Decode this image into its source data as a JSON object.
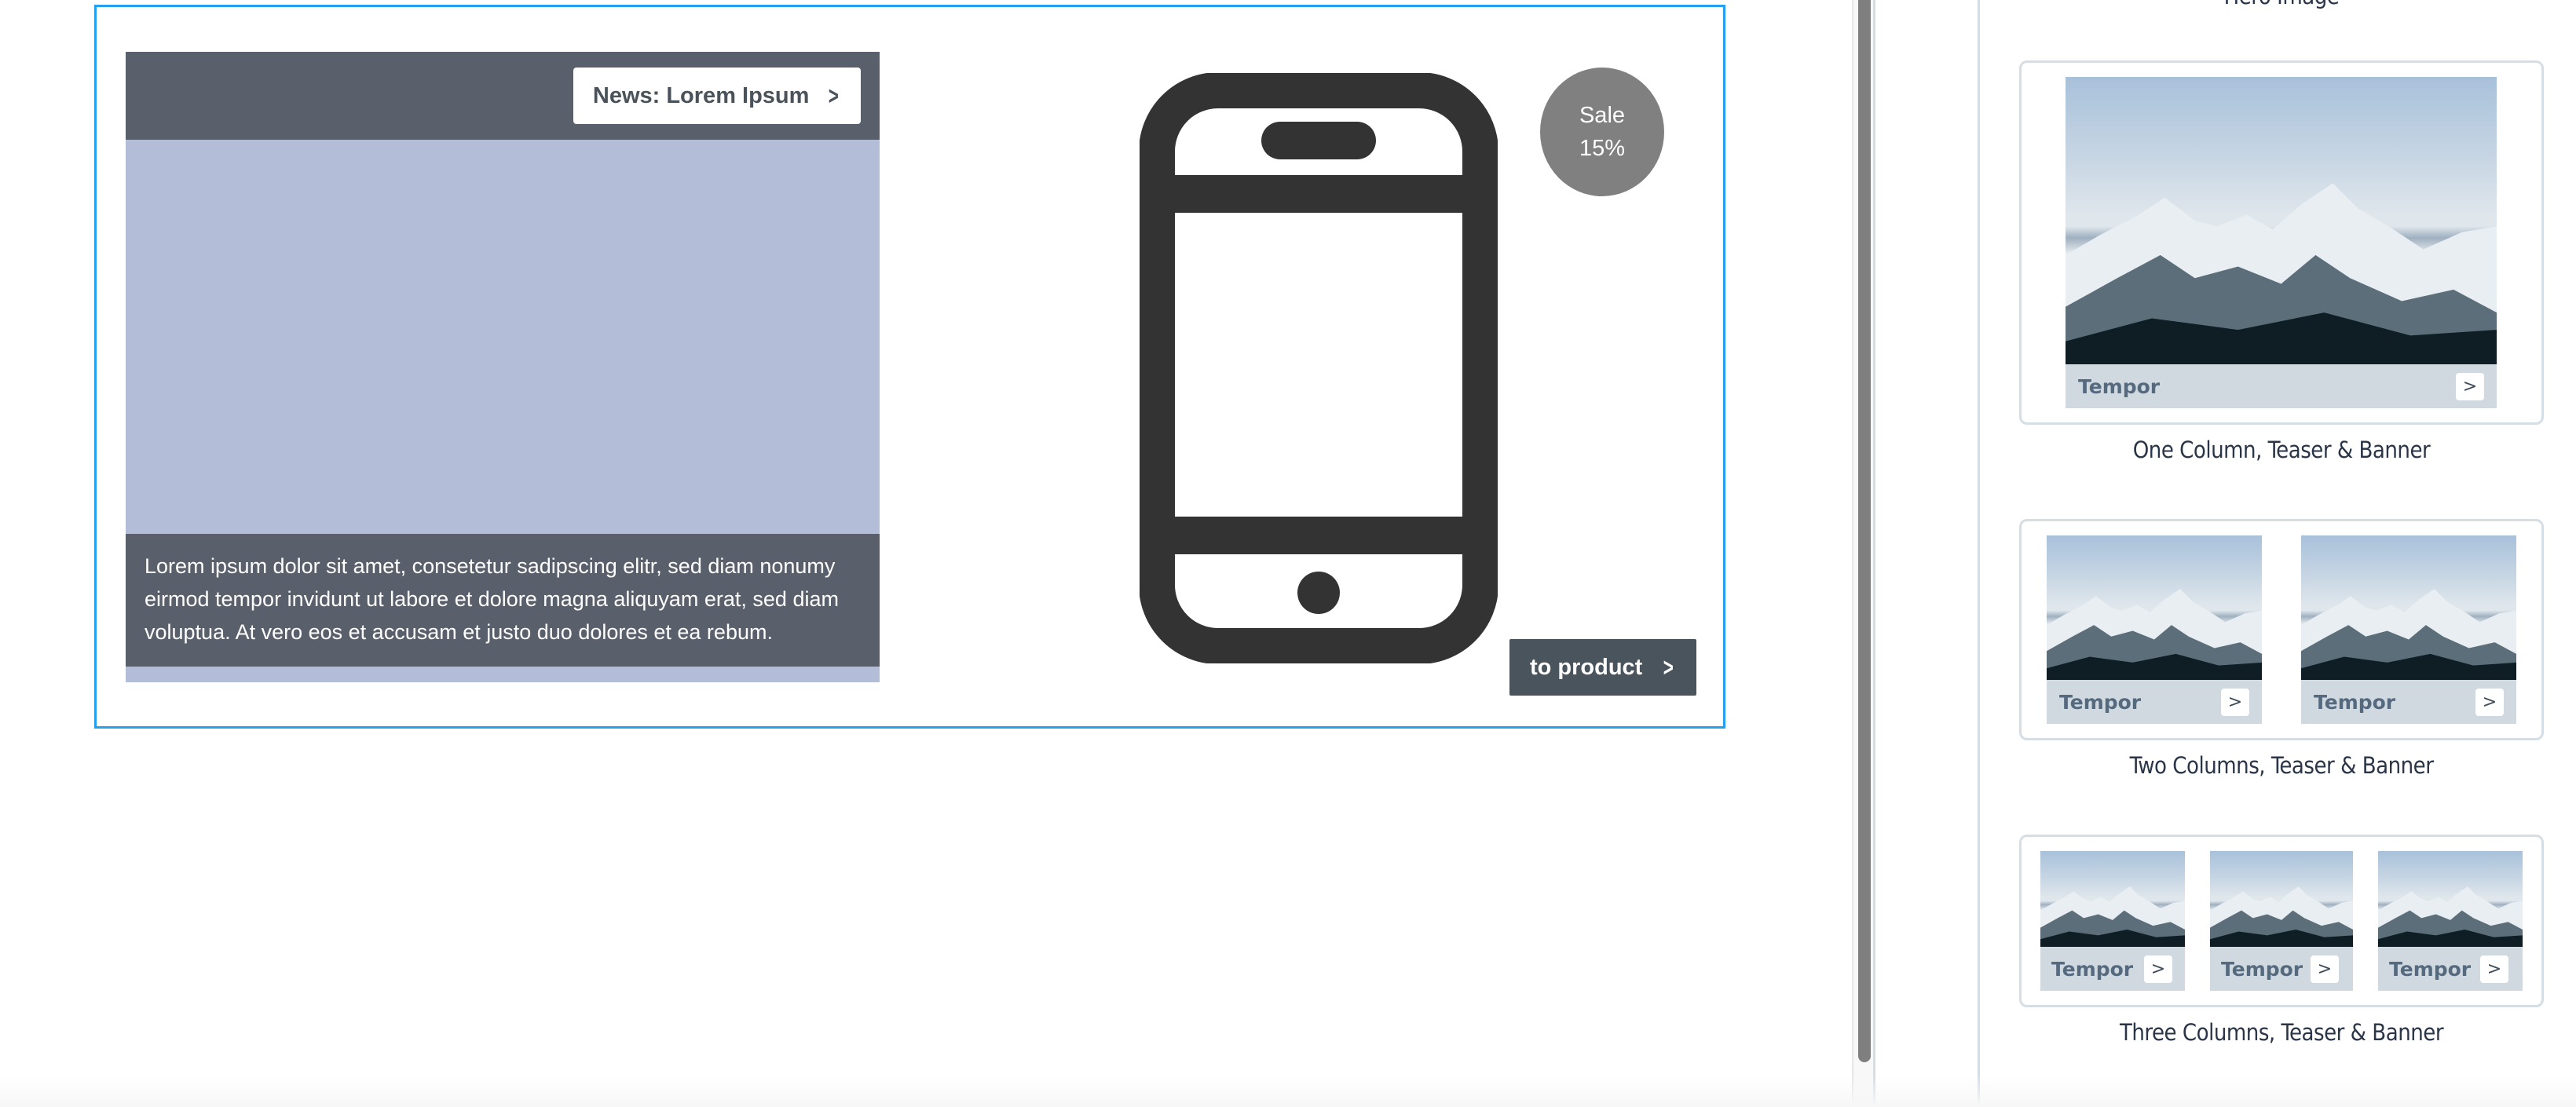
{
  "editor": {
    "news_block": {
      "button_label": "News: Lorem Ipsum",
      "button_icon": "chevron-right-icon",
      "body_text": "Lorem ipsum dolor sit amet, consetetur sadipscing elitr, sed diam nonumy eirmod tempor invidunt ut labore et dolore magna aliquyam erat, sed diam voluptua. At vero eos et accusam et justo duo dolores et ea rebum.",
      "header_color": "#5a606b",
      "placeholder_color": "#b3bdd8"
    },
    "product_block": {
      "image_icon": "smartphone-icon",
      "sale_badge": {
        "line1": "Sale",
        "line2": "15%"
      },
      "button_label": "to product",
      "button_icon": "chevron-right-icon"
    },
    "selection_color": "#24a0f0"
  },
  "panel": {
    "templates": [
      {
        "label": "Hero Image",
        "columns": 0,
        "tiles": []
      },
      {
        "label": "One Column, Teaser & Banner",
        "columns": 1,
        "tiles": [
          {
            "caption": "Tempor",
            "button": ">"
          }
        ]
      },
      {
        "label": "Two Columns, Teaser & Banner",
        "columns": 2,
        "tiles": [
          {
            "caption": "Tempor",
            "button": ">"
          },
          {
            "caption": "Tempor",
            "button": ">"
          }
        ]
      },
      {
        "label": "Three Columns, Teaser & Banner",
        "columns": 3,
        "tiles": [
          {
            "caption": "Tempor",
            "button": ">"
          },
          {
            "caption": "Tempor",
            "button": ">"
          },
          {
            "caption": "Tempor",
            "button": ">"
          }
        ]
      }
    ],
    "thumbnail_subject": "snowy-mountain-image"
  }
}
